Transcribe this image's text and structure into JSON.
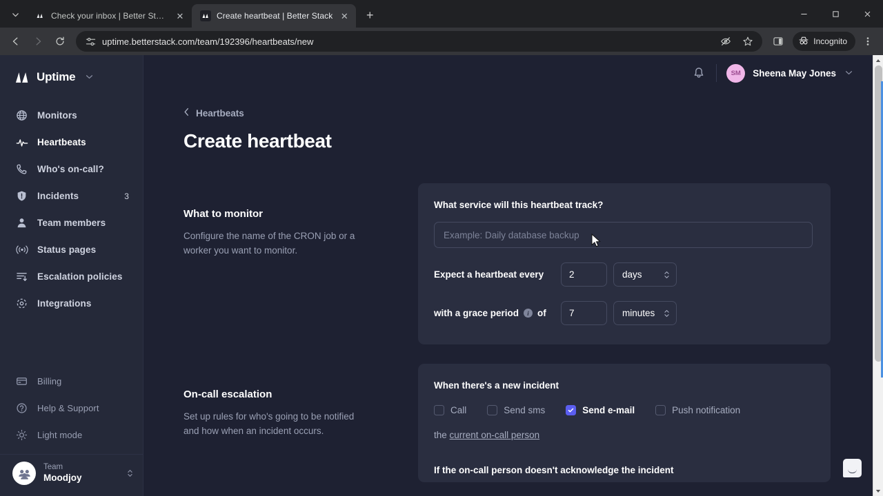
{
  "browser": {
    "tabs": [
      {
        "title": "Check your inbox | Better Stack",
        "active": false
      },
      {
        "title": "Create heartbeat | Better Stack",
        "active": true
      }
    ],
    "new_tab_label": "+",
    "tab_search_icon": "chevron-down-icon",
    "close_icon": "✕",
    "window_controls": {
      "minimize": "—",
      "maximize": "❐",
      "close": "✕"
    },
    "nav": {
      "back": "←",
      "forward": "→",
      "reload": "⟳"
    },
    "omnibox": {
      "site_icon": "tune-icon",
      "url": "uptime.betterstack.com/team/192396/heartbeats/new",
      "tracking_protection_icon": "eye-slash-icon",
      "bookmark_icon": "star-icon",
      "side_panel_icon": "split-panel-icon"
    },
    "incognito_label": "Incognito",
    "menu_icon": "kebab-menu-icon"
  },
  "sidebar": {
    "brand": {
      "name": "Uptime",
      "caret": "⌄"
    },
    "items": [
      {
        "label": "Monitors",
        "icon": "globe-icon",
        "badge": ""
      },
      {
        "label": "Heartbeats",
        "icon": "pulse-icon",
        "badge": "",
        "active": true
      },
      {
        "label": "Who's on-call?",
        "icon": "phone-icon",
        "badge": ""
      },
      {
        "label": "Incidents",
        "icon": "shield-alert-icon",
        "badge": "3"
      },
      {
        "label": "Team members",
        "icon": "user-icon",
        "badge": ""
      },
      {
        "label": "Status pages",
        "icon": "broadcast-icon",
        "badge": ""
      },
      {
        "label": "Escalation policies",
        "icon": "escalation-icon",
        "badge": ""
      },
      {
        "label": "Integrations",
        "icon": "integrations-icon",
        "badge": ""
      }
    ],
    "bottom_items": [
      {
        "label": "Billing",
        "icon": "card-icon"
      },
      {
        "label": "Help & Support",
        "icon": "question-circle-icon"
      },
      {
        "label": "Light mode",
        "icon": "sun-icon"
      }
    ],
    "team": {
      "label": "Team",
      "name": "Moodjoy",
      "avatar_icon": "group-icon"
    }
  },
  "topbar": {
    "bell_icon": "bell-icon",
    "user": {
      "initials": "SM",
      "name": "Sheena May Jones",
      "caret": "⌄"
    }
  },
  "main": {
    "breadcrumb": {
      "chevron": "‹",
      "label": "Heartbeats"
    },
    "title": "Create heartbeat",
    "sections": [
      {
        "title": "What to monitor",
        "description": "Configure the name of the CRON job or a worker you want to monitor."
      },
      {
        "title": "On-call escalation",
        "description": "Set up rules for who's going to be notified and how when an incident occurs."
      }
    ],
    "monitor_card": {
      "title": "What service will this heartbeat track?",
      "service_name_value": "",
      "service_name_placeholder": "Example: Daily database backup",
      "expect_label": "Expect a heartbeat every",
      "expect_value": "2",
      "expect_unit": "days",
      "grace_label_before": "with a grace period",
      "grace_info_icon": "i",
      "grace_label_after": "of",
      "grace_value": "7",
      "grace_unit": "minutes"
    },
    "escalation_card": {
      "title": "When there's a new incident",
      "channels": [
        {
          "label": "Call",
          "checked": false
        },
        {
          "label": "Send sms",
          "checked": false
        },
        {
          "label": "Send e-mail",
          "checked": true
        },
        {
          "label": "Push notification",
          "checked": false
        }
      ],
      "subline_prefix": "the",
      "subline_link": "current on-call person",
      "footer": "If the on-call person doesn't acknowledge the incident"
    },
    "chat_widget_icon": "chat-smile-icon"
  },
  "colors": {
    "page_bg": "#1e2132",
    "sidebar_bg": "#252939",
    "card_bg": "#2a2e40",
    "accent": "#5b5ef0",
    "avatar": "#f0b6e8"
  }
}
